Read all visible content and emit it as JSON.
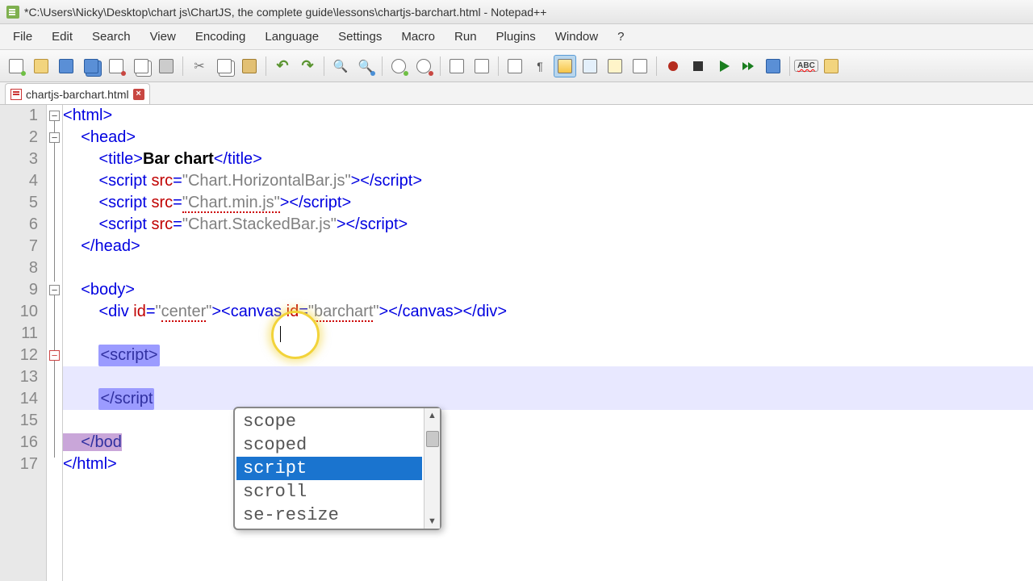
{
  "title": "*C:\\Users\\Nicky\\Desktop\\chart js\\ChartJS, the complete guide\\lessons\\chartjs-barchart.html - Notepad++",
  "menu": [
    "File",
    "Edit",
    "Search",
    "View",
    "Encoding",
    "Language",
    "Settings",
    "Macro",
    "Run",
    "Plugins",
    "Window",
    "?"
  ],
  "tab": {
    "label": "chartjs-barchart.html"
  },
  "abc": "ABC",
  "gutter": [
    "1",
    "2",
    "3",
    "4",
    "5",
    "6",
    "7",
    "8",
    "9",
    "10",
    "11",
    "12",
    "13",
    "14",
    "15",
    "16",
    "17"
  ],
  "code": {
    "l1": {
      "a": "<",
      "b": "html",
      "c": ">"
    },
    "l2": {
      "a": "    <",
      "b": "head",
      "c": ">"
    },
    "l3": {
      "a": "        <",
      "b": "title",
      "c": ">",
      "d": "Bar chart",
      "e": "</",
      "f": "title",
      "g": ">"
    },
    "l4": {
      "a": "        <",
      "b": "script",
      "c": " ",
      "d": "src",
      "e": "=",
      "f": "\"Chart.HorizontalBar.js\"",
      "g": "></",
      "h": "script",
      "i": ">"
    },
    "l5": {
      "a": "        <",
      "b": "script",
      "c": " ",
      "d": "src",
      "e": "=",
      "f": "\"Chart.min.js\"",
      "g": "></",
      "h": "script",
      "i": ">"
    },
    "l6": {
      "a": "        <",
      "b": "script",
      "c": " ",
      "d": "src",
      "e": "=",
      "f": "\"Chart.StackedBar.js\"",
      "g": "></",
      "h": "script",
      "i": ">"
    },
    "l7": {
      "a": "    </",
      "b": "head",
      "c": ">"
    },
    "l9": {
      "a": "    <",
      "b": "body",
      "c": ">"
    },
    "l10": {
      "a": "        <",
      "b": "div",
      "c": " ",
      "d": "id",
      "e": "=",
      "f": "\"",
      "g": "center",
      "h": "\"",
      "i": "><",
      "j": "canvas",
      "k": " ",
      "l": "id",
      "m": "=",
      "n": "\"",
      "o": "barchart",
      "p": "\"",
      "q": "></",
      "r": "canvas",
      "s": "></",
      "t": "div",
      "u": ">"
    },
    "l12": "        <script>",
    "l14": "        </script",
    "l16a": "    ",
    "l16b": "</bod",
    "l17": {
      "a": "</",
      "b": "html",
      "c": ">"
    }
  },
  "autocomplete": {
    "items": [
      "scope",
      "scoped",
      "script",
      "scroll",
      "se-resize"
    ],
    "selected": 2
  }
}
